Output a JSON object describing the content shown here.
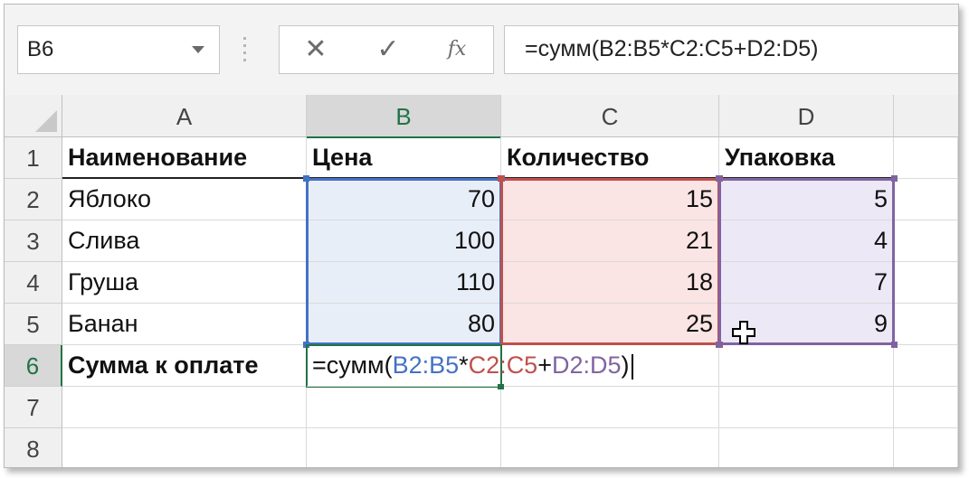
{
  "formula_bar": {
    "name_box": "B6",
    "buttons": {
      "cancel": "✕",
      "enter": "✓",
      "insert_function": "fx"
    },
    "formula": "=сумм(B2:B5*C2:C5+D2:D5)"
  },
  "columns": [
    "A",
    "B",
    "C",
    "D"
  ],
  "rows": [
    "1",
    "2",
    "3",
    "4",
    "5",
    "6",
    "7",
    "8"
  ],
  "selected_column": "B",
  "selected_row": "6",
  "table": {
    "headers": [
      "Наименование",
      "Цена",
      "Количество",
      "Упаковка"
    ],
    "data": [
      [
        "Яблоко",
        "70",
        "15",
        "5"
      ],
      [
        "Слива",
        "100",
        "21",
        "4"
      ],
      [
        "Груша",
        "110",
        "18",
        "7"
      ],
      [
        "Банан",
        "80",
        "25",
        "9"
      ]
    ],
    "total_label": "Сумма к оплате"
  },
  "editing_cell": {
    "address": "B6",
    "tokens": [
      "=сумм(",
      "B2:B5",
      "*",
      "C2:C5",
      "+",
      "D2:D5",
      ")"
    ]
  },
  "colors": {
    "accent": "#217346",
    "range_b": "#4472c4",
    "range_c": "#c0504d",
    "range_d": "#8064a2"
  },
  "icons": {
    "name_box_dropdown": "chevron-down-icon",
    "pointer": "cross-cursor-icon"
  }
}
